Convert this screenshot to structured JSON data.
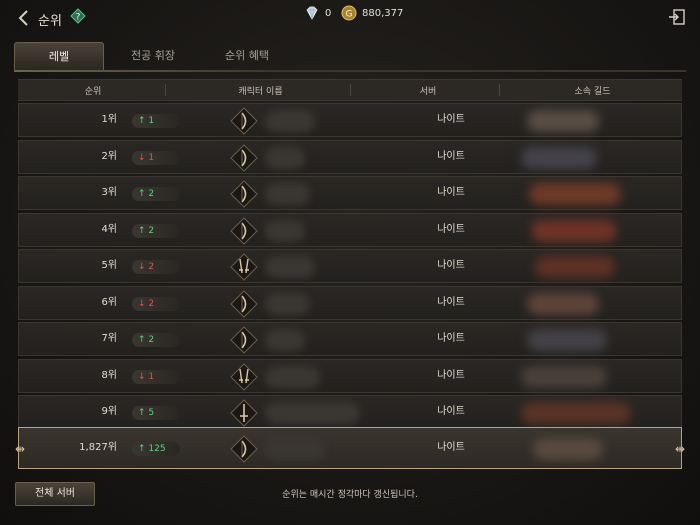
{
  "header": {
    "title": "순위",
    "diamond_count": "0",
    "gold_count": "880,377"
  },
  "tabs": [
    {
      "label": "레벨",
      "active": true
    },
    {
      "label": "전공 휘장",
      "active": false
    },
    {
      "label": "순위 혜택",
      "active": false
    }
  ],
  "table": {
    "headers": [
      "순위",
      "캐릭터 이름",
      "서버",
      "소속 길드"
    ],
    "rows": [
      {
        "rank": "1위",
        "change": "1",
        "direction": "up",
        "class_icon": "bow-icon",
        "server": "나이트",
        "guild_color": "#5a4d45"
      },
      {
        "rank": "2위",
        "change": "1",
        "direction": "down",
        "class_icon": "bow-icon",
        "server": "나이트",
        "guild_color": "#44434a"
      },
      {
        "rank": "3위",
        "change": "2",
        "direction": "up",
        "class_icon": "bow-icon",
        "server": "나이트",
        "guild_color": "#6e3a28"
      },
      {
        "rank": "4위",
        "change": "2",
        "direction": "up",
        "class_icon": "bow-icon",
        "server": "나이트",
        "guild_color": "#6e3326"
      },
      {
        "rank": "5위",
        "change": "2",
        "direction": "down",
        "class_icon": "daggers-icon",
        "server": "나이트",
        "guild_color": "#5e3125"
      },
      {
        "rank": "6위",
        "change": "2",
        "direction": "down",
        "class_icon": "bow-icon",
        "server": "나이트",
        "guild_color": "#5e443a"
      },
      {
        "rank": "7위",
        "change": "2",
        "direction": "up",
        "class_icon": "bow-icon",
        "server": "나이트",
        "guild_color": "#444247"
      },
      {
        "rank": "8위",
        "change": "1",
        "direction": "down",
        "class_icon": "daggers-icon",
        "server": "나이트",
        "guild_color": "#4a403a"
      },
      {
        "rank": "9위",
        "change": "5",
        "direction": "up",
        "class_icon": "sword-icon",
        "server": "나이트",
        "guild_color": "#5a3326"
      }
    ],
    "my_row": {
      "rank": "1,827위",
      "change": "125",
      "direction": "up",
      "class_icon": "bow-icon",
      "server": "나이트",
      "guild_color": "#5a4a40"
    }
  },
  "footer": {
    "all_server_label": "전체 서버",
    "notice": "순위는 매시간 정각마다 갱신됩니다."
  },
  "colors": {
    "up": "#5fd17a",
    "down": "#e1554c",
    "highlight_border": "#b8a57e"
  }
}
